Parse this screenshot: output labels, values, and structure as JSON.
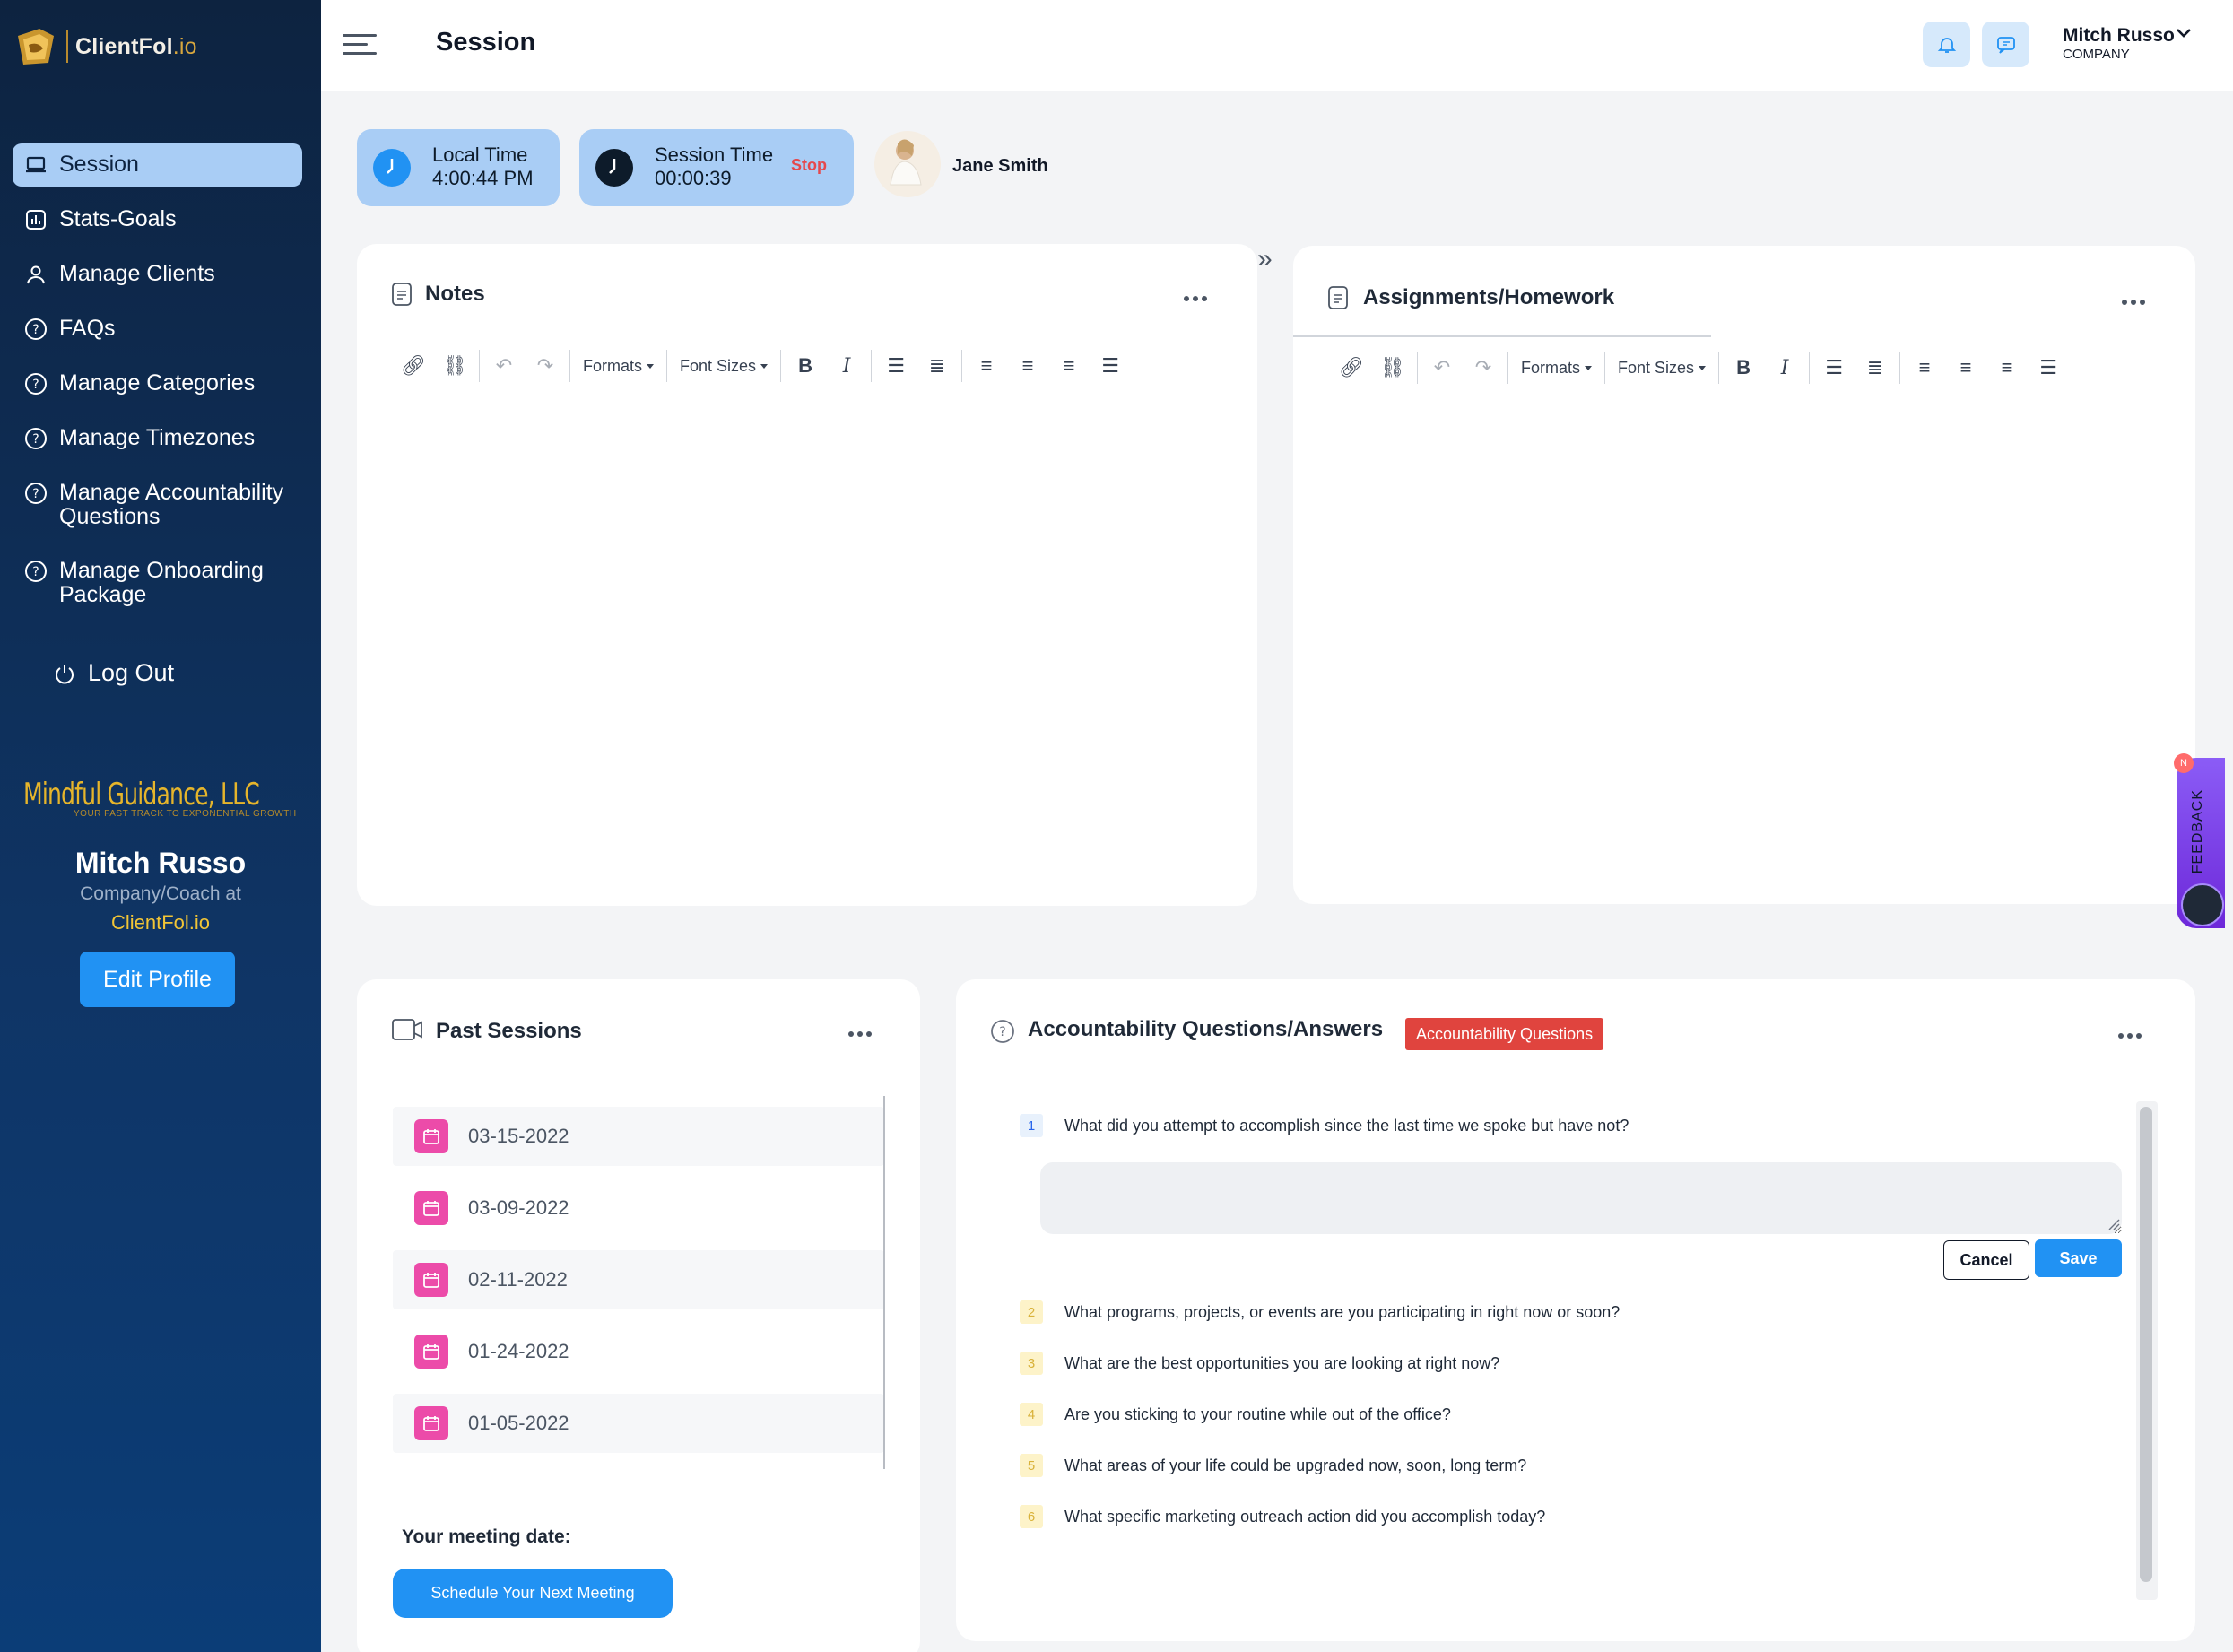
{
  "brand": {
    "name": "ClientFol",
    "tld": ".io"
  },
  "sidebar": {
    "items": [
      {
        "label": "Session",
        "icon": "laptop-icon"
      },
      {
        "label": "Stats-Goals",
        "icon": "bar-chart-icon"
      },
      {
        "label": "Manage Clients",
        "icon": "user-icon"
      },
      {
        "label": "FAQs",
        "icon": "question-circle-icon"
      },
      {
        "label": "Manage Categories",
        "icon": "question-circle-icon"
      },
      {
        "label": "Manage Timezones",
        "icon": "question-circle-icon"
      },
      {
        "label": "Manage Accountability Questions",
        "icon": "question-circle-icon"
      },
      {
        "label": "Manage Onboarding Package",
        "icon": "question-circle-icon"
      }
    ],
    "logout_label": "Log Out"
  },
  "org": {
    "name": "Mindful Guidance, LLC",
    "tagline": "YOUR FAST TRACK TO EXPONENTIAL GROWTH"
  },
  "profile": {
    "name": "Mitch Russo",
    "role": "Company/Coach at",
    "org": "ClientFol.io",
    "edit_label": "Edit Profile"
  },
  "header": {
    "title": "Session",
    "user_name": "Mitch Russo",
    "user_company": "COMPANY"
  },
  "time": {
    "local_label": "Local Time",
    "local_value": "4:00:44 PM",
    "session_label": "Session Time",
    "session_value": "00:00:39",
    "stop_label": "Stop"
  },
  "client": {
    "name": "Jane Smith"
  },
  "editor": {
    "formats_label": "Formats",
    "font_sizes_label": "Font Sizes",
    "bold": "B",
    "italic": "I"
  },
  "notes": {
    "title": "Notes"
  },
  "assignments": {
    "title": "Assignments/Homework"
  },
  "past_sessions": {
    "title": "Past Sessions",
    "dates": [
      "03-15-2022",
      "03-09-2022",
      "02-11-2022",
      "01-24-2022",
      "01-05-2022"
    ],
    "meeting_label": "Your meeting date:",
    "schedule_label": "Schedule Your Next Meeting"
  },
  "accountability": {
    "title": "Accountability Questions/Answers",
    "badge": "Accountability Questions",
    "questions": [
      {
        "num": "1",
        "text": "What did you attempt to accomplish since the last time we spoke but have not?"
      },
      {
        "num": "2",
        "text": "What programs, projects, or events are you participating in right now or soon?"
      },
      {
        "num": "3",
        "text": "What are the best opportunities you are looking at right now?"
      },
      {
        "num": "4",
        "text": "Are you sticking to your routine while out of the office?"
      },
      {
        "num": "5",
        "text": "What areas of your life could be upgraded now, soon, long term?"
      },
      {
        "num": "6",
        "text": "What specific marketing outreach action did you accomplish today?"
      }
    ],
    "cancel_label": "Cancel",
    "save_label": "Save"
  },
  "feedback": {
    "label": "FEEDBACK",
    "count": "N"
  },
  "colors": {
    "sidebar": "#0f3566",
    "accent": "#2192f3",
    "active": "#a9cdf5",
    "badge": "#e0443e",
    "calendar": "#ec4ba9"
  }
}
